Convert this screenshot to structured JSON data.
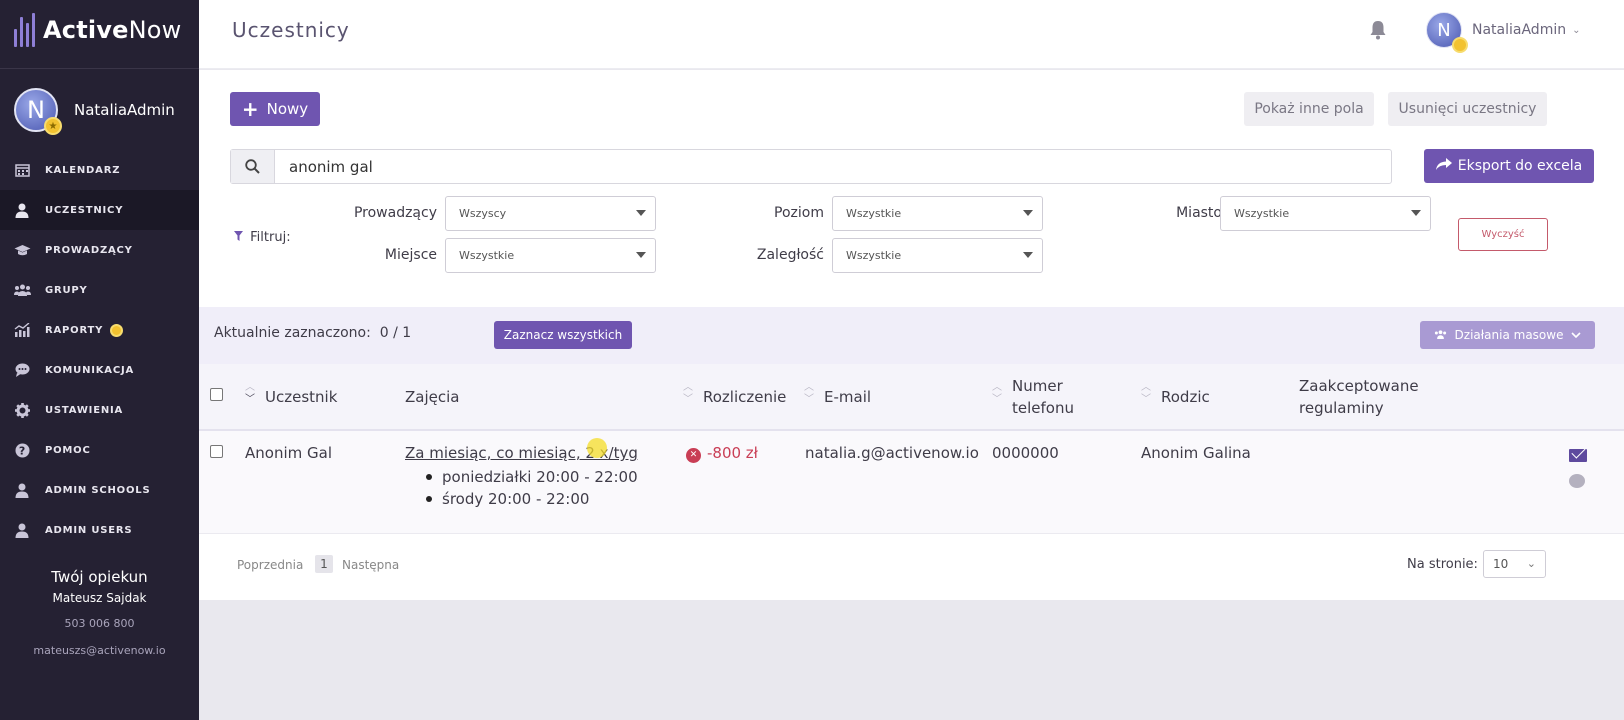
{
  "brand": {
    "name_bold": "Active",
    "name_light": "Now"
  },
  "sidebar": {
    "user": {
      "initial": "N",
      "name": "NataliaAdmin"
    },
    "items": [
      {
        "label": "KALENDARZ",
        "icon": "calendar-icon"
      },
      {
        "label": "UCZESTNICY",
        "icon": "user-icon"
      },
      {
        "label": "PROWADZĄCY",
        "icon": "graduation-cap-icon"
      },
      {
        "label": "GRUPY",
        "icon": "group-icon"
      },
      {
        "label": "RAPORTY",
        "icon": "chart-icon"
      },
      {
        "label": "KOMUNIKACJA",
        "icon": "chat-icon"
      },
      {
        "label": "USTAWIENIA",
        "icon": "gear-icon"
      },
      {
        "label": "POMOC",
        "icon": "help-icon"
      },
      {
        "label": "ADMIN SCHOOLS",
        "icon": "user-icon"
      },
      {
        "label": "ADMIN USERS",
        "icon": "user-icon"
      }
    ],
    "active_item": "UCZESTNICY",
    "guardian": {
      "title": "Twój opiekun",
      "name": "Mateusz Sajdak",
      "phone": "503 006 800",
      "email": "mateuszs@activenow.io"
    }
  },
  "header": {
    "title": "Uczestnicy",
    "user": {
      "initial": "N",
      "name": "NataliaAdmin"
    }
  },
  "toolbar": {
    "new_label": "Nowy",
    "show_fields_label": "Pokaż inne pola",
    "deleted_label": "Usunięci uczestnicy",
    "export_label": "Eksport do excela"
  },
  "search": {
    "value": "anonim gal"
  },
  "filters": {
    "label": "Filtruj:",
    "prowadzacy": {
      "label": "Prowadzący",
      "value": "Wszyscy"
    },
    "poziom": {
      "label": "Poziom",
      "value": "Wszystkie"
    },
    "miasto": {
      "label": "Miasto",
      "value": "Wszystkie"
    },
    "miejsce": {
      "label": "Miejsce",
      "value": "Wszystkie"
    },
    "zaleglosc": {
      "label": "Zaległość",
      "value": "Wszystkie"
    },
    "clear_label": "Wyczyść"
  },
  "selection": {
    "label": "Aktualnie zaznaczono:",
    "count": "0 / 1",
    "select_all_label": "Zaznacz wszystkich",
    "bulk_actions_label": "Działania masowe"
  },
  "table": {
    "columns": [
      "Uczestnik",
      "Zajęcia",
      "Rozliczenie",
      "E-mail",
      "Numer telefonu",
      "Rodzic",
      "Zaakceptowane regulaminy"
    ],
    "col_phone_line1": "Numer",
    "col_phone_line2": "telefonu",
    "col_regs_line1": "Zaakceptowane",
    "col_regs_line2": "regulaminy",
    "rows": [
      {
        "uczestnik": "Anonim Gal",
        "zajecia": "Za miesiąc, co miesiąc, 2 x/tyg",
        "schedule": [
          "poniedziałki 20:00 - 22:00",
          "środy 20:00 - 22:00"
        ],
        "rozliczenie": "-800 zł",
        "email": "natalia.g@activenow.io",
        "telefon": "0000000",
        "rodzic": "Anonim Galina"
      }
    ]
  },
  "pagination": {
    "prev_label": "Poprzednia",
    "page": "1",
    "next_label": "Następna",
    "per_page_label": "Na stronie:",
    "per_page": "10"
  },
  "colors": {
    "sidebar_bg": "#252133",
    "accent": "#6f55b0",
    "negative": "#c93e55"
  }
}
